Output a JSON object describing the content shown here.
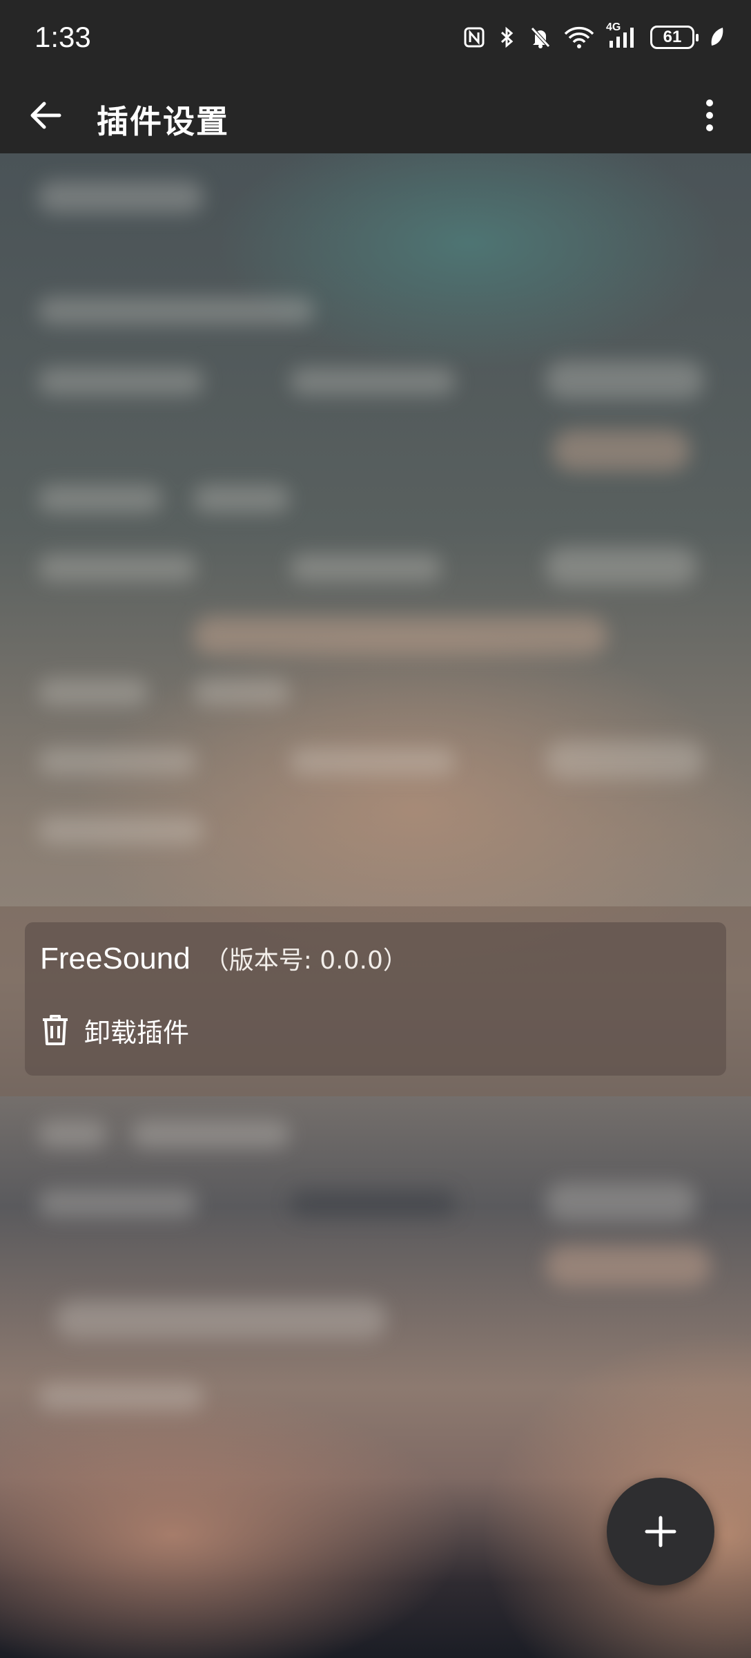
{
  "status_bar": {
    "time": "1:33",
    "battery": "61",
    "network_label": "4G",
    "icons": [
      "nfc-icon",
      "bluetooth-icon",
      "mute-icon",
      "wifi-icon",
      "signal-icon",
      "battery-icon",
      "leaf-icon"
    ]
  },
  "app_bar": {
    "title": "插件设置",
    "back_icon": "arrow-left-icon",
    "more_icon": "more-vertical-icon"
  },
  "plugin_sheet": {
    "name": "FreeSound",
    "version": "（版本号: 0.0.0）",
    "actions": [
      {
        "label": "卸载插件",
        "icon": "trash-icon"
      }
    ]
  },
  "fab": {
    "icon": "plus-icon"
  },
  "colors": {
    "bar_bg": "#262626",
    "fab_bg": "#2e2e30",
    "text": "#ffffff"
  }
}
